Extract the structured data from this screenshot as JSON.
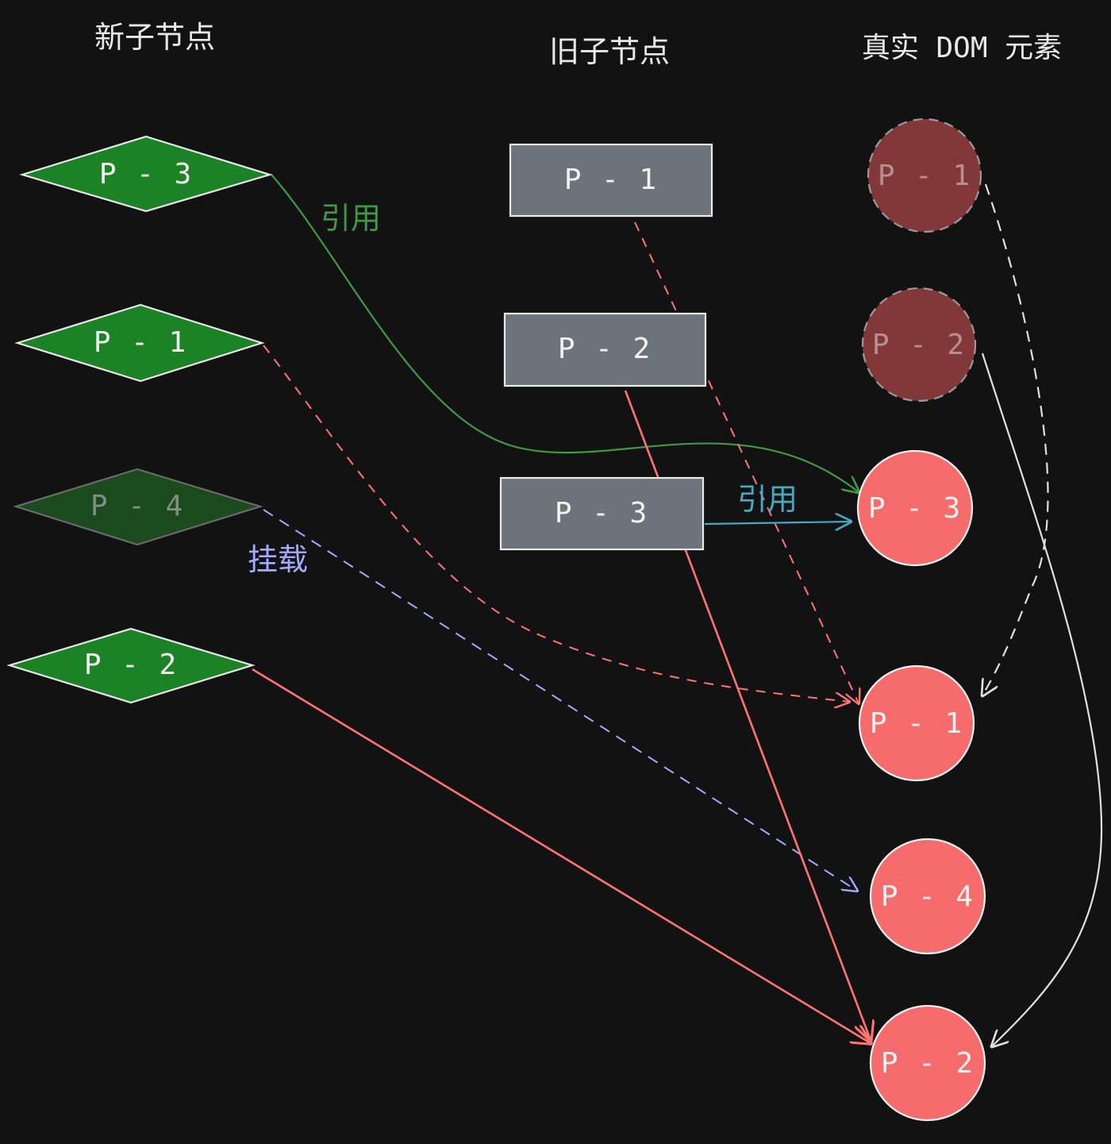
{
  "headers": {
    "new_children": "新子节点",
    "old_children": "旧子节点",
    "real_dom": "真实 DOM 元素"
  },
  "new_children": [
    {
      "label": "P - 3",
      "state": "active"
    },
    {
      "label": "P - 1",
      "state": "active"
    },
    {
      "label": "P - 4",
      "state": "new-unmatched"
    },
    {
      "label": "P - 2",
      "state": "active"
    }
  ],
  "old_children": [
    {
      "label": "P - 1"
    },
    {
      "label": "P - 2"
    },
    {
      "label": "P - 3"
    }
  ],
  "real_dom": [
    {
      "label": "P - 1",
      "state": "moved-away"
    },
    {
      "label": "P - 2",
      "state": "moved-away"
    },
    {
      "label": "P - 3",
      "state": "current"
    },
    {
      "label": "P - 1",
      "state": "current"
    },
    {
      "label": "P - 4",
      "state": "current"
    },
    {
      "label": "P - 2",
      "state": "current"
    }
  ],
  "edge_labels": {
    "ref_green": "引用",
    "ref_blue": "引用",
    "mount": "挂载"
  },
  "colors": {
    "background": "#121212",
    "diamond_green": "#1b8226",
    "diamond_dim": "#1a4a1e",
    "rect_gray": "#6c737a",
    "circle_red": "#f66b6b",
    "circle_dim": "#823838",
    "edge_green": "#3f9a46",
    "edge_red": "#ff7373",
    "edge_blue": "#47a8c2",
    "edge_purple": "#a7a8ff",
    "edge_white": "#e0e0e0"
  }
}
